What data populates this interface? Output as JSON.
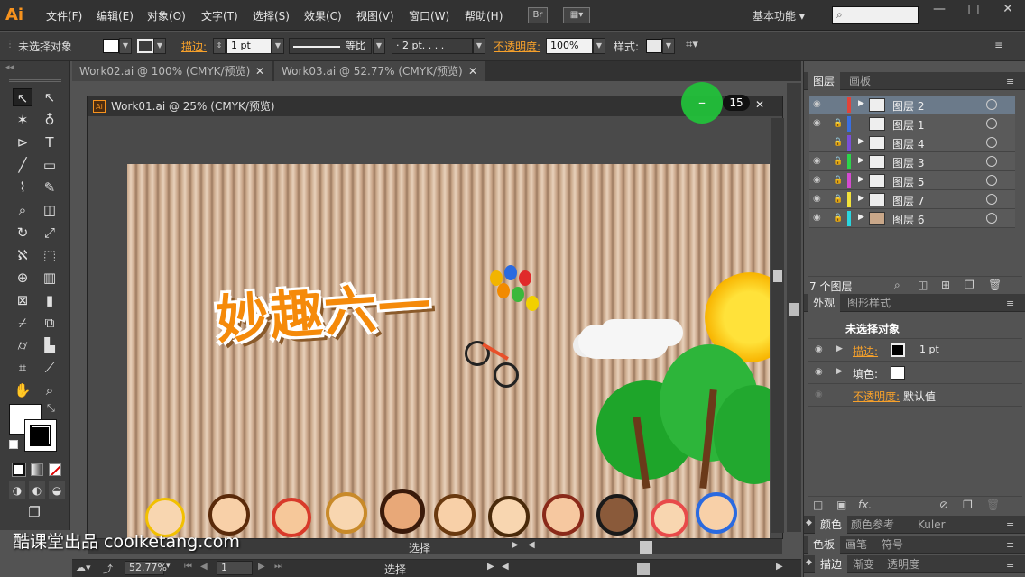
{
  "app": {
    "logo": "Ai"
  },
  "menubar": {
    "items": [
      "文件(F)",
      "编辑(E)",
      "对象(O)",
      "文字(T)",
      "选择(S)",
      "效果(C)",
      "视图(V)",
      "窗口(W)",
      "帮助(H)"
    ],
    "bridge": "Br",
    "workspace": "基本功能",
    "window_controls": [
      "—",
      "□",
      "✕"
    ]
  },
  "controlbar": {
    "selection": "未选择对象",
    "stroke_label": "描边:",
    "stroke_weight": "1 pt",
    "stroke_style": "等比",
    "brush_size": "· 2 pt. . . .",
    "opacity_label": "不透明度:",
    "opacity_value": "100%",
    "style_label": "样式:"
  },
  "tabs": [
    {
      "label": "Work02.ai @ 100% (CMYK/预览)",
      "close": "✕"
    },
    {
      "label": "Work03.ai @ 52.77% (CMYK/预览)",
      "close": "✕"
    }
  ],
  "document": {
    "title": "Work01.ai @ 25% (CMYK/预览)",
    "ai_icon": "Ai",
    "minimize": "–",
    "counter": "15",
    "close": "✕",
    "artwork_text": "妙趣六一",
    "status_mode": "选择"
  },
  "bottom_status": {
    "zoom": "52.77%",
    "page": "1",
    "mode": "选择"
  },
  "watermark": "酷课堂出品 coolketang.com",
  "layers_panel": {
    "tabs": [
      "图层",
      "画板"
    ],
    "layers": [
      {
        "name": "图层 2",
        "color": "#e0443a",
        "selected": true,
        "eye": true,
        "lock": false
      },
      {
        "name": "图层 1",
        "color": "#3a6fe0",
        "selected": false,
        "eye": true,
        "lock": true
      },
      {
        "name": "图层 4",
        "color": "#7a4fd8",
        "selected": false,
        "eye": false,
        "lock": true
      },
      {
        "name": "图层 3",
        "color": "#2bd44a",
        "selected": false,
        "eye": true,
        "lock": true
      },
      {
        "name": "图层 5",
        "color": "#d44ad0",
        "selected": false,
        "eye": true,
        "lock": true
      },
      {
        "name": "图层 7",
        "color": "#f2e23a",
        "selected": false,
        "eye": true,
        "lock": true
      },
      {
        "name": "图层 6",
        "color": "#2ad6e0",
        "selected": false,
        "eye": true,
        "lock": true
      }
    ],
    "count": "7 个图层"
  },
  "appearance_panel": {
    "tabs": [
      "外观",
      "图形样式"
    ],
    "header": "未选择对象",
    "stroke_label": "描边:",
    "stroke_value": "1 pt",
    "fill_label": "填色:",
    "opacity_label": "不透明度:",
    "opacity_value": "默认值",
    "fx": "fx."
  },
  "color_panel": {
    "tabs": [
      "颜色",
      "颜色参考",
      "Kuler"
    ]
  },
  "swatch_panel": {
    "tabs": [
      "色板",
      "画笔",
      "符号"
    ]
  },
  "stroke_panel": {
    "tabs": [
      "描边",
      "渐变",
      "透明度"
    ]
  }
}
